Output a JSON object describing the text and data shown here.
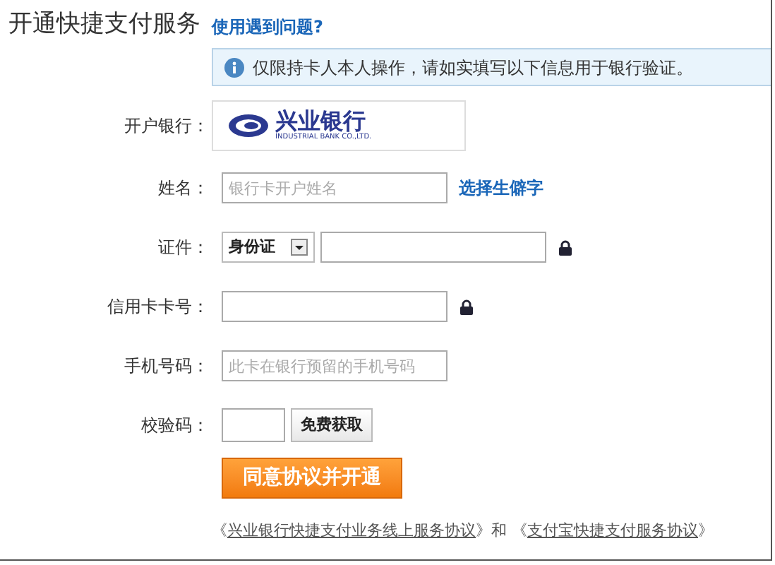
{
  "header": {
    "title": "开通快捷支付服务",
    "help_link": "使用遇到问题?"
  },
  "notice": "仅限持卡人本人操作，请如实填写以下信息用于银行验证。",
  "form": {
    "rows": [
      {
        "kind": "bank",
        "label": "开户银行：",
        "bank_name": "兴业银行",
        "bank_subtitle": "INDUSTRIAL BANK CO.,LTD."
      },
      {
        "kind": "text",
        "label": "姓名：",
        "placeholder": "银行卡开户姓名",
        "link": "选择生僻字"
      },
      {
        "kind": "id",
        "label": "证件：",
        "select": "身份证",
        "locked": true
      },
      {
        "kind": "text",
        "label": "信用卡卡号：",
        "locked": true
      },
      {
        "kind": "text",
        "label": "手机号码：",
        "placeholder": "此卡在银行预留的手机号码"
      },
      {
        "kind": "code",
        "label": "校验码：",
        "button": "免费获取"
      }
    ],
    "submit": "同意协议并开通",
    "agreement": [
      {
        "kind": "text",
        "text": "《"
      },
      {
        "kind": "link",
        "text": "兴业银行快捷支付业务线上服务协议"
      },
      {
        "kind": "text",
        "text": "》和 《"
      },
      {
        "kind": "link",
        "text": "支付宝快捷支付服务协议"
      },
      {
        "kind": "text",
        "text": "》"
      }
    ]
  }
}
